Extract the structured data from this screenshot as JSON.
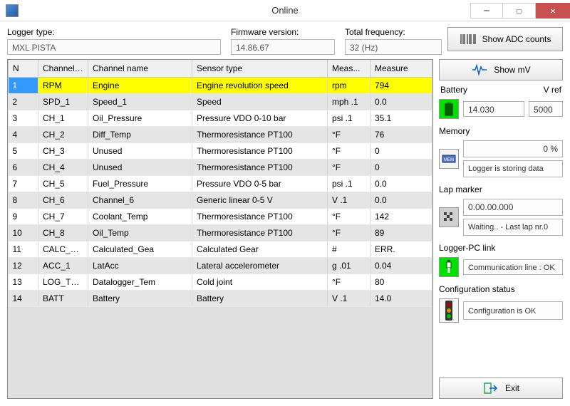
{
  "window": {
    "title": "Online"
  },
  "top": {
    "logger_label": "Logger type:",
    "logger_value": "MXL PISTA",
    "fw_label": "Firmware version:",
    "fw_value": "14.86.67",
    "freq_label": "Total frequency:",
    "freq_value": "32 (Hz)"
  },
  "columns": {
    "n": "N",
    "ch_id": "Channel i...",
    "ch_name": "Channel name",
    "sensor": "Sensor type",
    "unit": "Meas...",
    "measure": "Measure"
  },
  "rows": [
    {
      "n": "1",
      "id": "RPM",
      "name": "Engine",
      "sensor": "Engine revolution speed",
      "unit": "rpm",
      "measure": "794",
      "selected": true
    },
    {
      "n": "2",
      "id": "SPD_1",
      "name": "Speed_1",
      "sensor": "Speed",
      "unit": "mph .1",
      "measure": "0.0"
    },
    {
      "n": "3",
      "id": "CH_1",
      "name": "Oil_Pressure",
      "sensor": "Pressure VDO 0-10 bar",
      "unit": "psi .1",
      "measure": "35.1"
    },
    {
      "n": "4",
      "id": "CH_2",
      "name": "Diff_Temp",
      "sensor": "Thermoresistance PT100",
      "unit": "°F",
      "measure": "76"
    },
    {
      "n": "5",
      "id": "CH_3",
      "name": "Unused",
      "sensor": "Thermoresistance PT100",
      "unit": "°F",
      "measure": "0"
    },
    {
      "n": "6",
      "id": "CH_4",
      "name": "Unused",
      "sensor": "Thermoresistance PT100",
      "unit": "°F",
      "measure": "0"
    },
    {
      "n": "7",
      "id": "CH_5",
      "name": "Fuel_Pressure",
      "sensor": "Pressure VDO 0-5 bar",
      "unit": "psi .1",
      "measure": "0.0"
    },
    {
      "n": "8",
      "id": "CH_6",
      "name": "Channel_6",
      "sensor": "Generic linear 0-5 V",
      "unit": "V .1",
      "measure": "0.0"
    },
    {
      "n": "9",
      "id": "CH_7",
      "name": "Coolant_Temp",
      "sensor": "Thermoresistance PT100",
      "unit": "°F",
      "measure": "142"
    },
    {
      "n": "10",
      "id": "CH_8",
      "name": "Oil_Temp",
      "sensor": "Thermoresistance PT100",
      "unit": "°F",
      "measure": "89"
    },
    {
      "n": "11",
      "id": "CALC_GE...",
      "name": "Calculated_Gea",
      "sensor": "Calculated Gear",
      "unit": "#",
      "measure": "ERR."
    },
    {
      "n": "12",
      "id": "ACC_1",
      "name": "LatAcc",
      "sensor": "Lateral accelerometer",
      "unit": "g .01",
      "measure": "0.04"
    },
    {
      "n": "13",
      "id": "LOG_TMP",
      "name": "Datalogger_Tem",
      "sensor": "Cold joint",
      "unit": "°F",
      "measure": "80"
    },
    {
      "n": "14",
      "id": "BATT",
      "name": "Battery",
      "sensor": "Battery",
      "unit": "V .1",
      "measure": "14.0"
    }
  ],
  "side": {
    "adc_button": "Show ADC counts",
    "mv_button": "Show mV",
    "battery_label": "Battery",
    "vref_label": "V ref",
    "battery_value": "14.030",
    "vref_value": "5000",
    "memory_label": "Memory",
    "memory_pct": "0 %",
    "memory_status": "Logger is storing data",
    "lap_label": "Lap marker",
    "lap_time": "0.00.00.000",
    "lap_status": "Waiting.. - Last lap nr.0",
    "link_label": "Logger-PC link",
    "link_status": "Communication line : OK",
    "config_label": "Configuration status",
    "config_status": "Configuration is OK",
    "exit_button": "Exit"
  }
}
